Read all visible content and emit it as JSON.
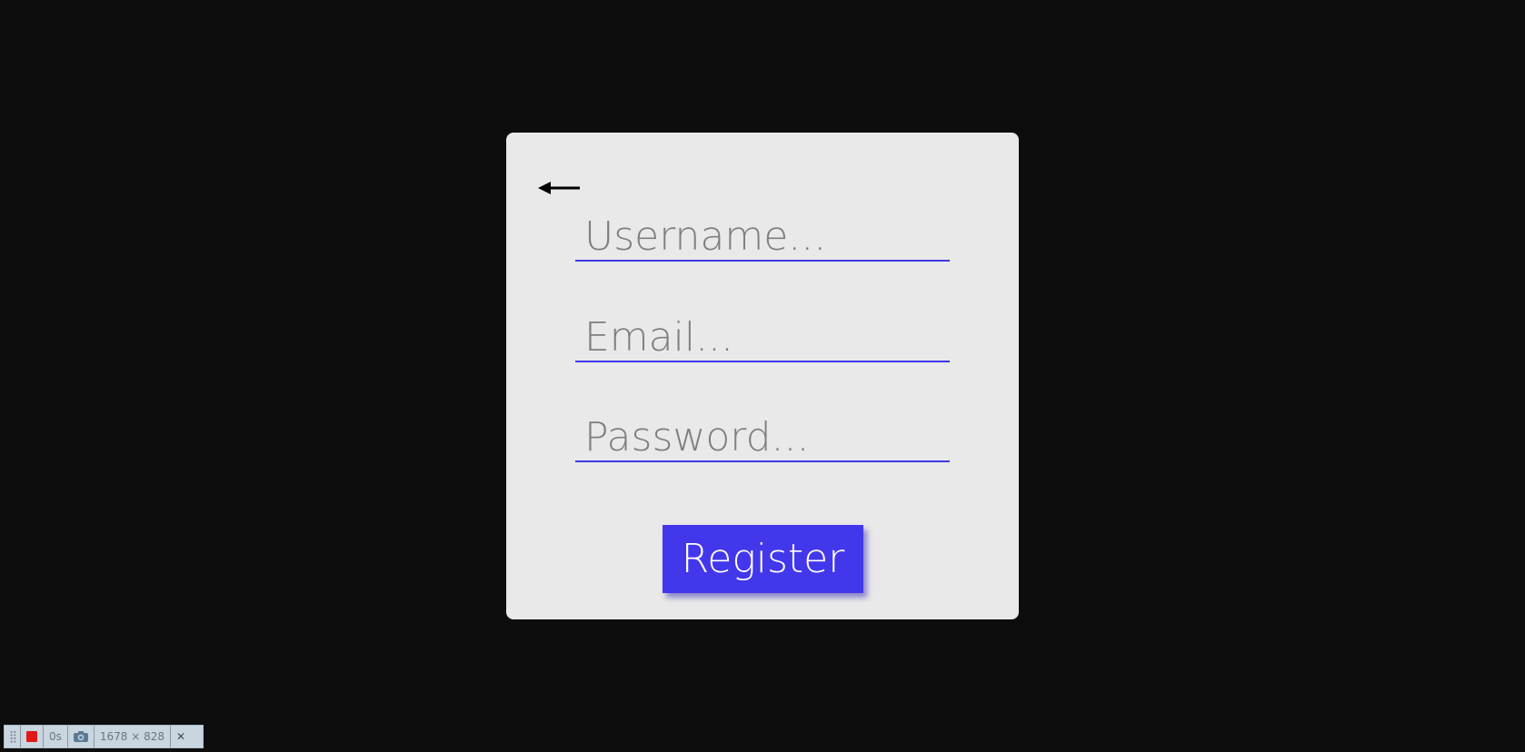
{
  "form": {
    "back_icon": "arrow-left-icon",
    "username_placeholder": "Username...",
    "email_placeholder": "Email...",
    "password_placeholder": "Password...",
    "register_label": "Register"
  },
  "colors": {
    "background": "#0d0d0d",
    "card": "#e9e9e9",
    "accent": "#4337ec",
    "placeholder": "#7e7e7e"
  },
  "recorder_bar": {
    "grip_icon": "drag-handle-icon",
    "record_icon": "stop-record-icon",
    "timer": "0s",
    "camera_icon": "camera-icon",
    "dimensions": "1678 × 828",
    "close_icon": "close-icon",
    "close_label": "✕"
  }
}
